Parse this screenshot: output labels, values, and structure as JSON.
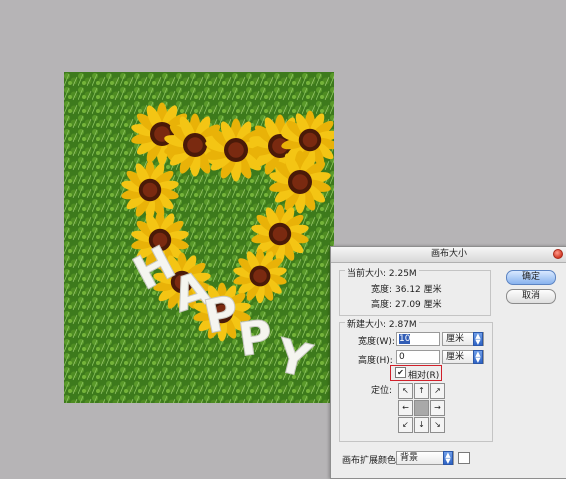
{
  "dialog": {
    "title": "画布大小",
    "current_size": {
      "label": "当前大小: 2.25M",
      "width_label": "宽度:",
      "width_value": "36.12 厘米",
      "height_label": "高度:",
      "height_value": "27.09 厘米"
    },
    "new_size": {
      "label": "新建大小: 2.87M",
      "width_label": "宽度(W):",
      "width_value": "10",
      "width_unit": "厘米",
      "height_label": "高度(H):",
      "height_value": "0",
      "height_unit": "厘米",
      "relative_label": "相对(R)",
      "relative_checked": "✔",
      "anchor_label": "定位:",
      "anchor_arrows": [
        "↖",
        "↑",
        "↗",
        "←",
        "",
        "→",
        "↙",
        "↓",
        "↘"
      ]
    },
    "extension_color": {
      "label": "画布扩展颜色:",
      "value": "背景"
    },
    "buttons": {
      "ok": "确定",
      "cancel": "取消"
    }
  },
  "canvas": {
    "image_text": "HAPPY"
  },
  "colors": {
    "workspace": "#b6b4b6",
    "grass": "#3f7a1f",
    "petal": "#f4c514",
    "flower_center": "#7a2a10",
    "highlight_box": "#d0202a"
  }
}
